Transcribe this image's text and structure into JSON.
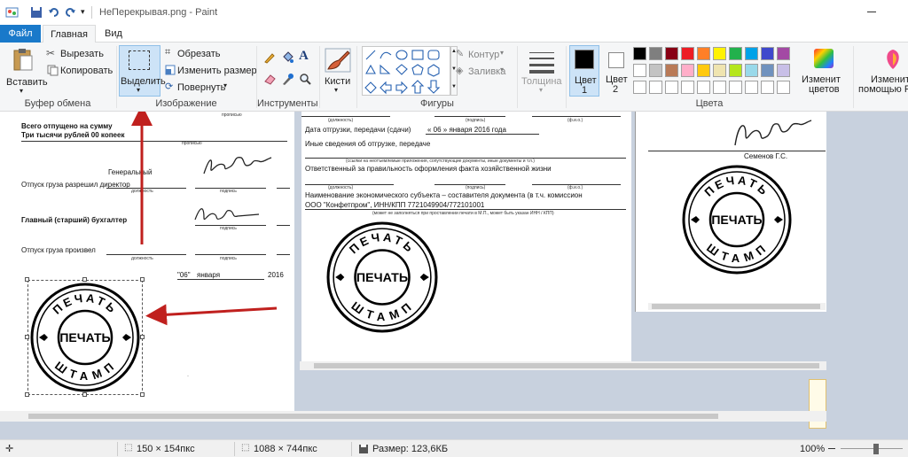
{
  "window": {
    "title": "НеПерекрывая.png - Paint"
  },
  "tabs": {
    "file": "Файл",
    "home": "Главная",
    "view": "Вид"
  },
  "ribbon": {
    "clipboard": {
      "paste": "Вставить",
      "cut": "Вырезать",
      "copy": "Копировать",
      "label": "Буфер обмена"
    },
    "image": {
      "select": "Выделить",
      "crop": "Обрезать",
      "resize": "Изменить размер",
      "rotate": "Повернуть",
      "label": "Изображение"
    },
    "tools": {
      "label": "Инструменты"
    },
    "brushes": {
      "label": "Кисти"
    },
    "shapes": {
      "outline": "Контур",
      "fill": "Заливка",
      "label": "Фигуры"
    },
    "size": {
      "label": "Толщина"
    },
    "colors": {
      "color1": "Цвет",
      "color1_num": "1",
      "color2": "Цвет",
      "color2_num": "2",
      "edit_line1": "Изменит",
      "edit_line2": "цветов",
      "paint3d_line1": "Изменить",
      "paint3d_line2": "помощью Pa",
      "label": "Цвета",
      "palette": [
        "#000000",
        "#7f7f7f",
        "#880015",
        "#ed1c24",
        "#ff7f27",
        "#fff200",
        "#22b14c",
        "#00a2e8",
        "#3f48cc",
        "#a349a4",
        "#ffffff",
        "#c3c3c3",
        "#b97a57",
        "#ffaec9",
        "#ffc90e",
        "#efe4b0",
        "#b5e61d",
        "#99d9ea",
        "#7092be",
        "#c8bfe7"
      ]
    }
  },
  "doc_left": {
    "top_tiny": "прописью",
    "total_line1": "Всего отпущено  на сумму",
    "total_line2": "Три тысячи рублей 00 копеек",
    "total_tiny": "прописью",
    "general": "Генеральный",
    "release_permitted": "Отпуск груза разрешил директор",
    "position_tiny": "должность",
    "signature_tiny": "подпись",
    "chief_accountant": "Главный (старший) бухгалтер",
    "chief_sig_tiny": "подпись",
    "release_done": "Отпуск груза произвел",
    "pos_tiny2": "должность",
    "sig_tiny2": "подпись",
    "date_day": "\"06\"",
    "date_month": "января",
    "date_year": "2016"
  },
  "doc_mid": {
    "position_tiny": "(должность)",
    "sign_tiny": "(подпись)",
    "fio_tiny": "(ф.и.о.)",
    "ship_date_label": "Дата отгрузки, передачи (сдачи)",
    "ship_date_value": "« 06 »  января  2016  года",
    "other_info": "Иные сведения об отгрузке, передаче",
    "attach_tiny": "(ссылки на неотъемлемые приложения, сопутствующие документы, иные документы и т.п.)",
    "responsible": "Ответственный за правильность оформления факта хозяйственной жизни",
    "position_tiny2": "(должность)",
    "sign_tiny2": "(подпись)",
    "fio_tiny2": "(ф.и.о.)",
    "entity_name": "Наименование экономического субъекта – составителя документа (в т.ч. комиссион",
    "entity_value": "ООО \"Конфетпром\", ИНН/КПП 7721049904/772101001",
    "entity_tiny": "(может не заполняться при проставлении печати в М.П., может быть указан ИНН / КПП)"
  },
  "doc_right": {
    "name": "Семенов Г.С."
  },
  "stamp": {
    "top": "ПЕЧАТЬ",
    "center": "ПЕЧАТЬ",
    "bottom": "ШТАМП"
  },
  "status": {
    "selection_size": "150 × 154пкс",
    "image_size": "1088 × 744пкс",
    "file_size": "Размер: 123,6КБ",
    "zoom": "100%"
  }
}
